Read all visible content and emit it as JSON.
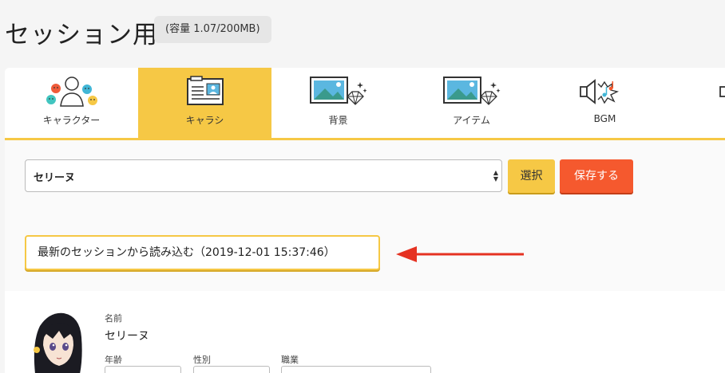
{
  "header": {
    "title": "セッション用",
    "capacity": "(容量 1.07/200MB)"
  },
  "tabs": [
    {
      "label": "キャラクター",
      "icon": "characters-icon",
      "active": false
    },
    {
      "label": "キャラシ",
      "icon": "character-sheet-icon",
      "active": true
    },
    {
      "label": "背景",
      "icon": "background-image-icon",
      "active": false
    },
    {
      "label": "アイテム",
      "icon": "item-image-icon",
      "active": false
    },
    {
      "label": "BGM",
      "icon": "bgm-speaker-icon",
      "active": false
    }
  ],
  "selector": {
    "selected": "セリーヌ",
    "select_button": "選択",
    "save_button": "保存する"
  },
  "load_latest": "最新のセッションから読み込む（2019-12-01 15:37:46）",
  "profile": {
    "name_label": "名前",
    "name_value": "セリーヌ",
    "age_label": "年齢",
    "gender_label": "性別",
    "job_label": "職業"
  },
  "colors": {
    "accent": "#f6c845",
    "save": "#f5592e",
    "arrow": "#e53222"
  }
}
